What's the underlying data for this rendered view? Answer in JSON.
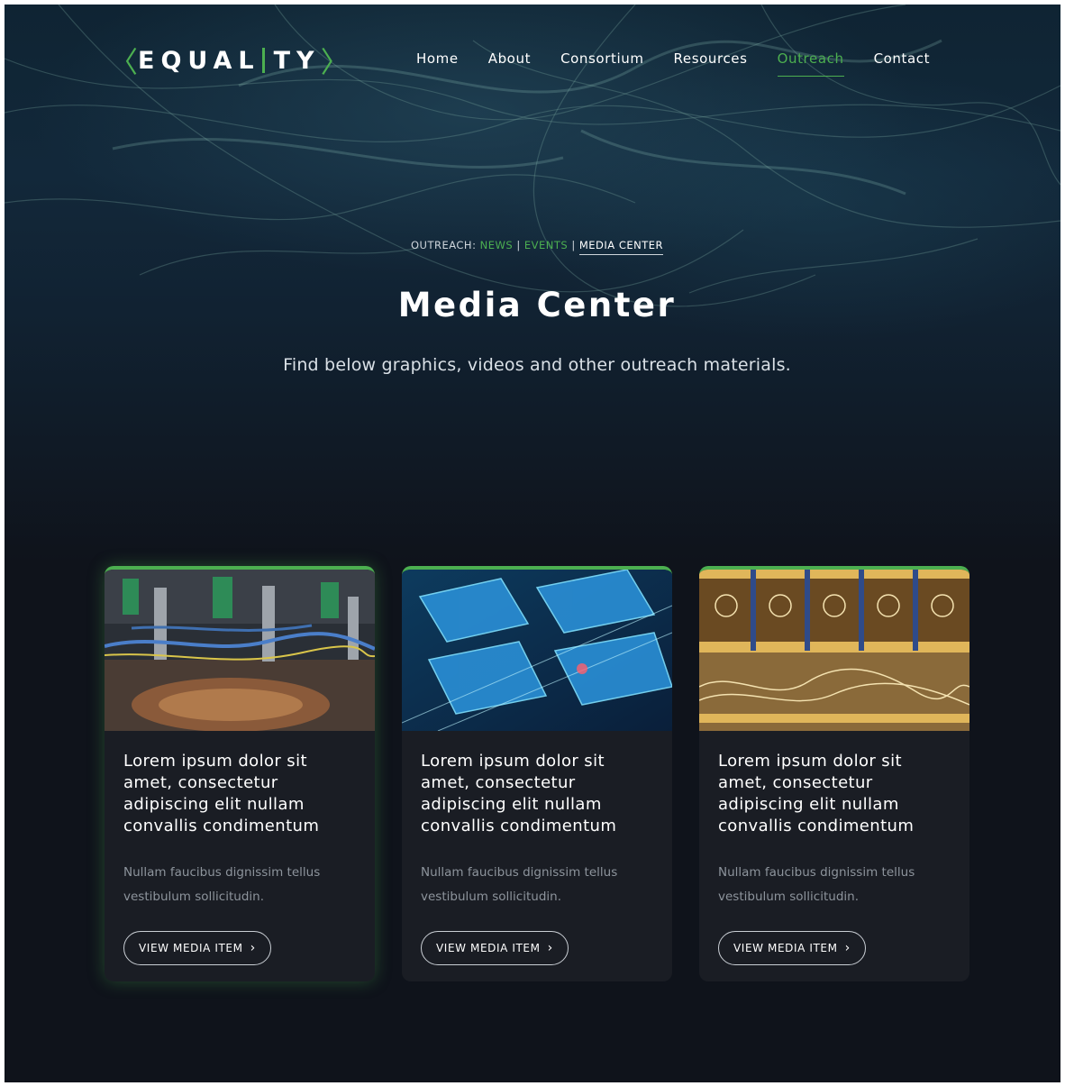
{
  "brand": {
    "logo_left": "EQUAL",
    "logo_right": "TY",
    "accent_color": "#4caf50"
  },
  "nav": {
    "items": [
      {
        "label": "Home"
      },
      {
        "label": "About"
      },
      {
        "label": "Consortium"
      },
      {
        "label": "Resources"
      },
      {
        "label": "Outreach",
        "active": true
      },
      {
        "label": "Contact"
      }
    ]
  },
  "breadcrumb": {
    "prefix": "OUTREACH:",
    "news": "NEWS",
    "sep1": "|",
    "events": "EVENTS",
    "sep2": "|",
    "current": "MEDIA CENTER"
  },
  "hero": {
    "title": "Media Center",
    "subtitle": "Find below graphics, videos and other outreach materials."
  },
  "cards": [
    {
      "image_icon": "lab-equipment-image",
      "title": "Lorem ipsum dolor sit amet, consectetur adipiscing elit nullam convallis condimentum",
      "description": "Nullam faucibus dignissim tellus vestibulum sollicitudin.",
      "button": "VIEW MEDIA ITEM"
    },
    {
      "image_icon": "chip-circuit-image",
      "title": "Lorem ipsum dolor sit amet, consectetur adipiscing elit nullam convallis condimentum",
      "description": "Nullam faucibus dignissim tellus vestibulum sollicitudin.",
      "button": "VIEW MEDIA ITEM"
    },
    {
      "image_icon": "quantum-computer-image",
      "title": "Lorem ipsum dolor sit amet, consectetur adipiscing elit nullam convallis condimentum",
      "description": "Nullam faucibus dignissim tellus vestibulum sollicitudin.",
      "button": "VIEW MEDIA ITEM"
    }
  ]
}
